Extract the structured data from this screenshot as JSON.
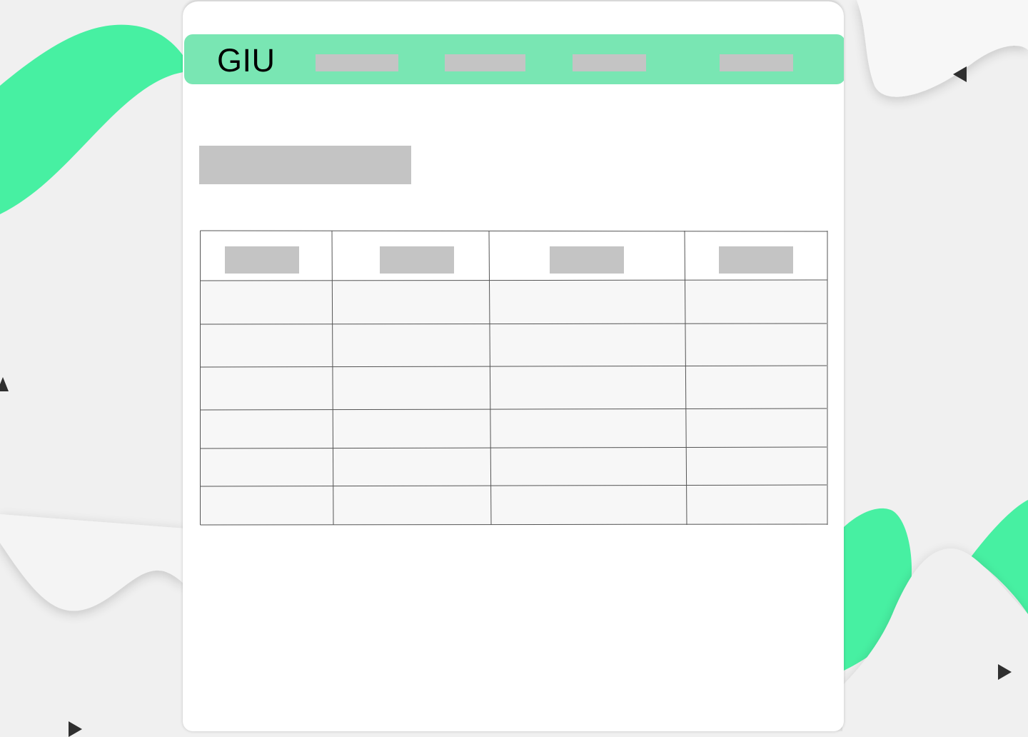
{
  "brand": {
    "name": "GIU"
  },
  "nav": {
    "items": [
      "",
      "",
      "",
      ""
    ]
  },
  "page": {
    "title": ""
  },
  "table": {
    "headers": [
      "",
      "",
      "",
      ""
    ],
    "rows": [
      [
        "",
        "",
        "",
        ""
      ],
      [
        "",
        "",
        "",
        ""
      ],
      [
        "",
        "",
        "",
        ""
      ],
      [
        "",
        "",
        "",
        ""
      ],
      [
        "",
        "",
        "",
        ""
      ],
      [
        "",
        "",
        "",
        ""
      ]
    ]
  },
  "colors": {
    "accent_green": "#47f0a2",
    "nav_green": "#79e6b3",
    "placeholder_gray": "#c4c4c4",
    "background": "#f0f0f0"
  },
  "icons": [
    "play-left-icon",
    "play-right-icon",
    "play-right-icon",
    "play-up-icon"
  ]
}
